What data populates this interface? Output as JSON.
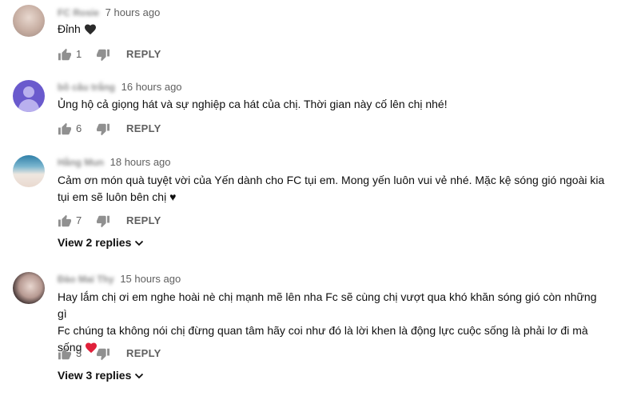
{
  "comments": [
    {
      "author": "FC Rosie",
      "time": "7 hours ago",
      "text": "Đỉnh",
      "emoji": "black-heart",
      "likes": "1",
      "reply_label": "REPLY"
    },
    {
      "author": "bồ câu trắng",
      "time": "16 hours ago",
      "text": "Ủng hộ cả giọng hát và sự nghiệp ca hát của chị. Thời gian này cố lên chị nhé!",
      "likes": "6",
      "reply_label": "REPLY"
    },
    {
      "author": "Hằng Mun",
      "time": "18 hours ago",
      "text_line1": "Cảm ơn món quà tuyệt vời của Yến dành cho FC tụi em. Mong yến luôn vui vẻ nhé. Mặc kệ sóng gió ngoài kia",
      "text_line2": "tụi em sẽ luôn bên chị ♥",
      "likes": "7",
      "reply_label": "REPLY",
      "view_replies": "View 2 replies"
    },
    {
      "author": "Đào Mai Thy",
      "time": "15 hours ago",
      "text_line1": "Hay lắm chị ơi em nghe hoài nè chị mạnh mẽ lên nha Fc sẽ cùng chị vượt qua khó khăn sóng gió còn những gì",
      "text_line2": "Fc chúng ta không nói chị đừng quan tâm hãy coi như đó là lời khen là động lực cuộc sống là phải lơ đi mà",
      "text_line3": "sống",
      "emoji": "red-heart",
      "likes": "3",
      "reply_label": "REPLY",
      "view_replies": "View 3 replies"
    }
  ],
  "icons": {
    "like": "thumbs-up-icon",
    "dislike": "thumbs-down-icon",
    "expand": "chevron-down-icon"
  },
  "colors": {
    "text": "#0f0f0f",
    "secondary": "#606060",
    "icon": "#909090",
    "red_heart": "#e0203a"
  }
}
